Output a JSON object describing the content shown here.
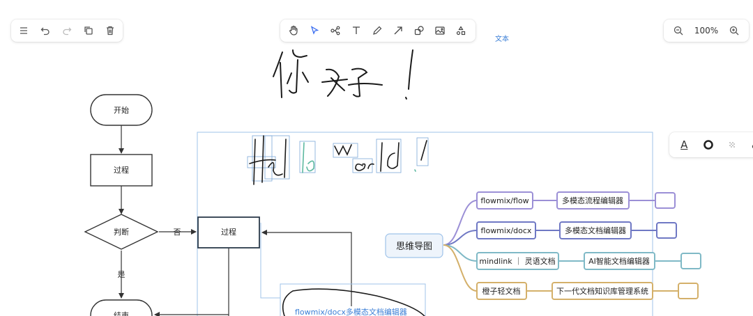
{
  "toolbar_left": {
    "items": [
      {
        "name": "menu-icon"
      },
      {
        "name": "undo-icon"
      },
      {
        "name": "redo-icon"
      },
      {
        "name": "copy-icon"
      },
      {
        "name": "trash-icon"
      }
    ]
  },
  "toolbar_center": {
    "items": [
      {
        "name": "hand-icon"
      },
      {
        "name": "pointer-icon",
        "active": true
      },
      {
        "name": "mindmap-icon"
      },
      {
        "name": "text-icon"
      },
      {
        "name": "pen-icon"
      },
      {
        "name": "arrow-icon"
      },
      {
        "name": "shape-icon"
      },
      {
        "name": "image-icon"
      },
      {
        "name": "more-shapes-icon"
      }
    ]
  },
  "text_mode_label": "文本",
  "zoom": {
    "level": "100%"
  },
  "style_toolbar": {
    "items": [
      {
        "name": "font-color-icon",
        "glyph": "A"
      },
      {
        "name": "stroke-color-icon"
      },
      {
        "name": "fill-pattern-icon"
      },
      {
        "name": "link-icon"
      }
    ]
  },
  "flowchart": {
    "start": "开始",
    "process1": "过程",
    "decision": "判断",
    "no_label": "否",
    "yes_label": "是",
    "process2": "过程",
    "end": "结束"
  },
  "handwriting": {
    "chinese": "你好！",
    "english": "Hello world !"
  },
  "mindmap": {
    "root": "思维导图",
    "branches": [
      {
        "label": "flowmix/flow",
        "child": "多模态流程编辑器",
        "color": "#9b8fd6"
      },
      {
        "label": "flowmix/docx",
        "child": "多模态文档编辑器",
        "color": "#6f78c4"
      },
      {
        "label": "mindlink ｜ 灵语文档",
        "child": "AI智能文档编辑器",
        "color": "#7fb9c6"
      },
      {
        "label": "橙子轻文档",
        "child": "下一代文档知识库管理系统",
        "color": "#d4b06a"
      }
    ]
  },
  "text_box": "flowmix/docx多模态文档编辑器",
  "colors": {
    "accent": "#3a7ed6",
    "selection": "#9fc3ea",
    "flow_stroke": "#2b3a4a"
  }
}
